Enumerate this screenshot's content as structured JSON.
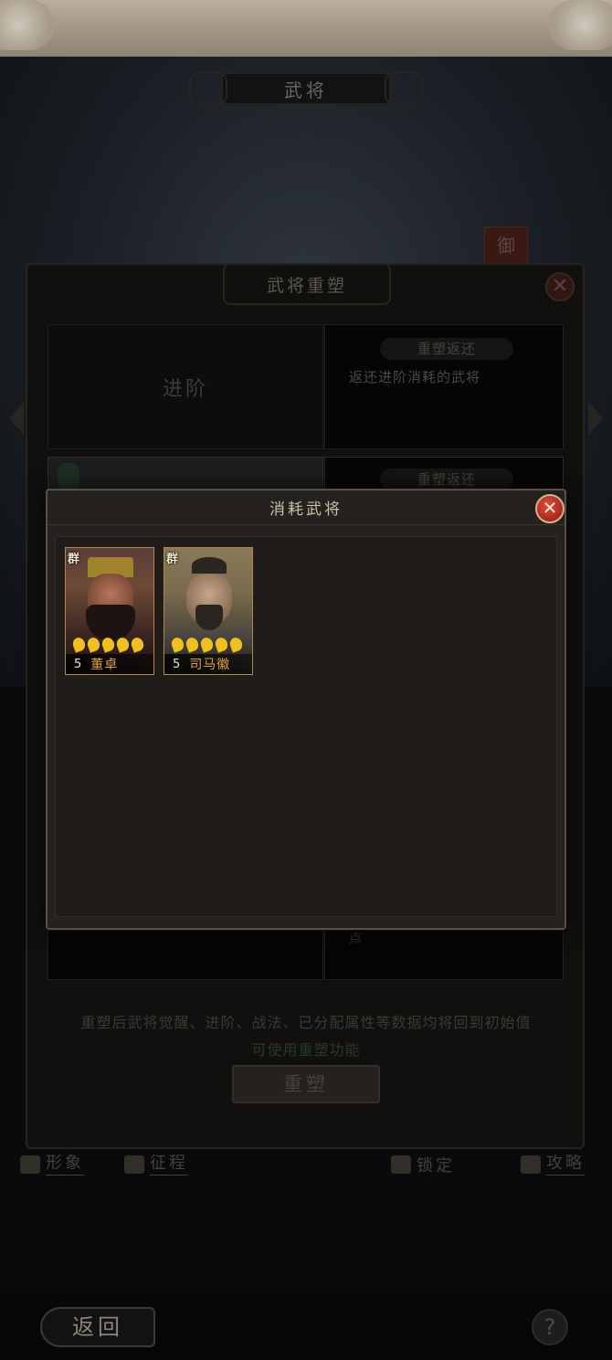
{
  "header": {
    "title": "武将"
  },
  "panel": {
    "title": "武将重塑",
    "left_cell_label": "进阶",
    "return_tag": "重塑返还",
    "return_desc": "返还进阶消耗的武将",
    "return_tag_2": "重塑返还",
    "lower_right_partial": "点",
    "notice": "重塑后武将觉醒、进阶、战法、已分配属性等数据均将回到初始值",
    "notice_green": "可使用重塑功能",
    "reforge_button": "重塑"
  },
  "side_pennant": "御",
  "bottom_nav": [
    {
      "label": "形象",
      "icon": "figure-icon"
    },
    {
      "label": "征程",
      "icon": "flag-icon"
    },
    {
      "label": "锁定",
      "icon": "lock-icon"
    },
    {
      "label": "攻略",
      "icon": "book-icon"
    }
  ],
  "footer": {
    "back_label": "返回",
    "help_label": "?"
  },
  "modal": {
    "title": "消耗武将",
    "cards": [
      {
        "faction": "群",
        "level": "5",
        "name": "董卓",
        "stars": 5
      },
      {
        "faction": "群",
        "level": "5",
        "name": "司马徽",
        "stars": 5
      }
    ]
  },
  "colors": {
    "card_name": "#e0a043",
    "star": "#f0c020",
    "close_red": "#c0342a"
  }
}
